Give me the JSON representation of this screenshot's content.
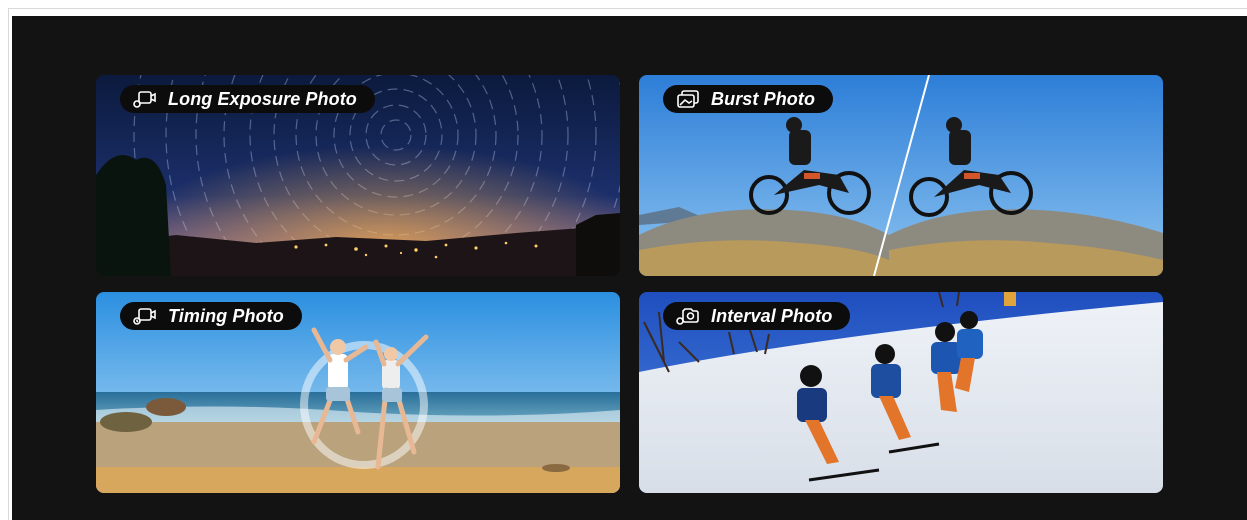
{
  "cards": [
    {
      "id": "long-exposure",
      "label": "Long Exposure Photo",
      "icon": "long-exposure-camera-icon"
    },
    {
      "id": "burst",
      "label": "Burst Photo",
      "icon": "burst-photos-icon"
    },
    {
      "id": "timing",
      "label": "Timing Photo",
      "icon": "timer-camera-icon"
    },
    {
      "id": "interval",
      "label": "Interval Photo",
      "icon": "interval-camera-icon"
    }
  ],
  "colors": {
    "panel_background": "#131313",
    "label_pill": "#0c0c0c",
    "label_text": "#ffffff"
  }
}
